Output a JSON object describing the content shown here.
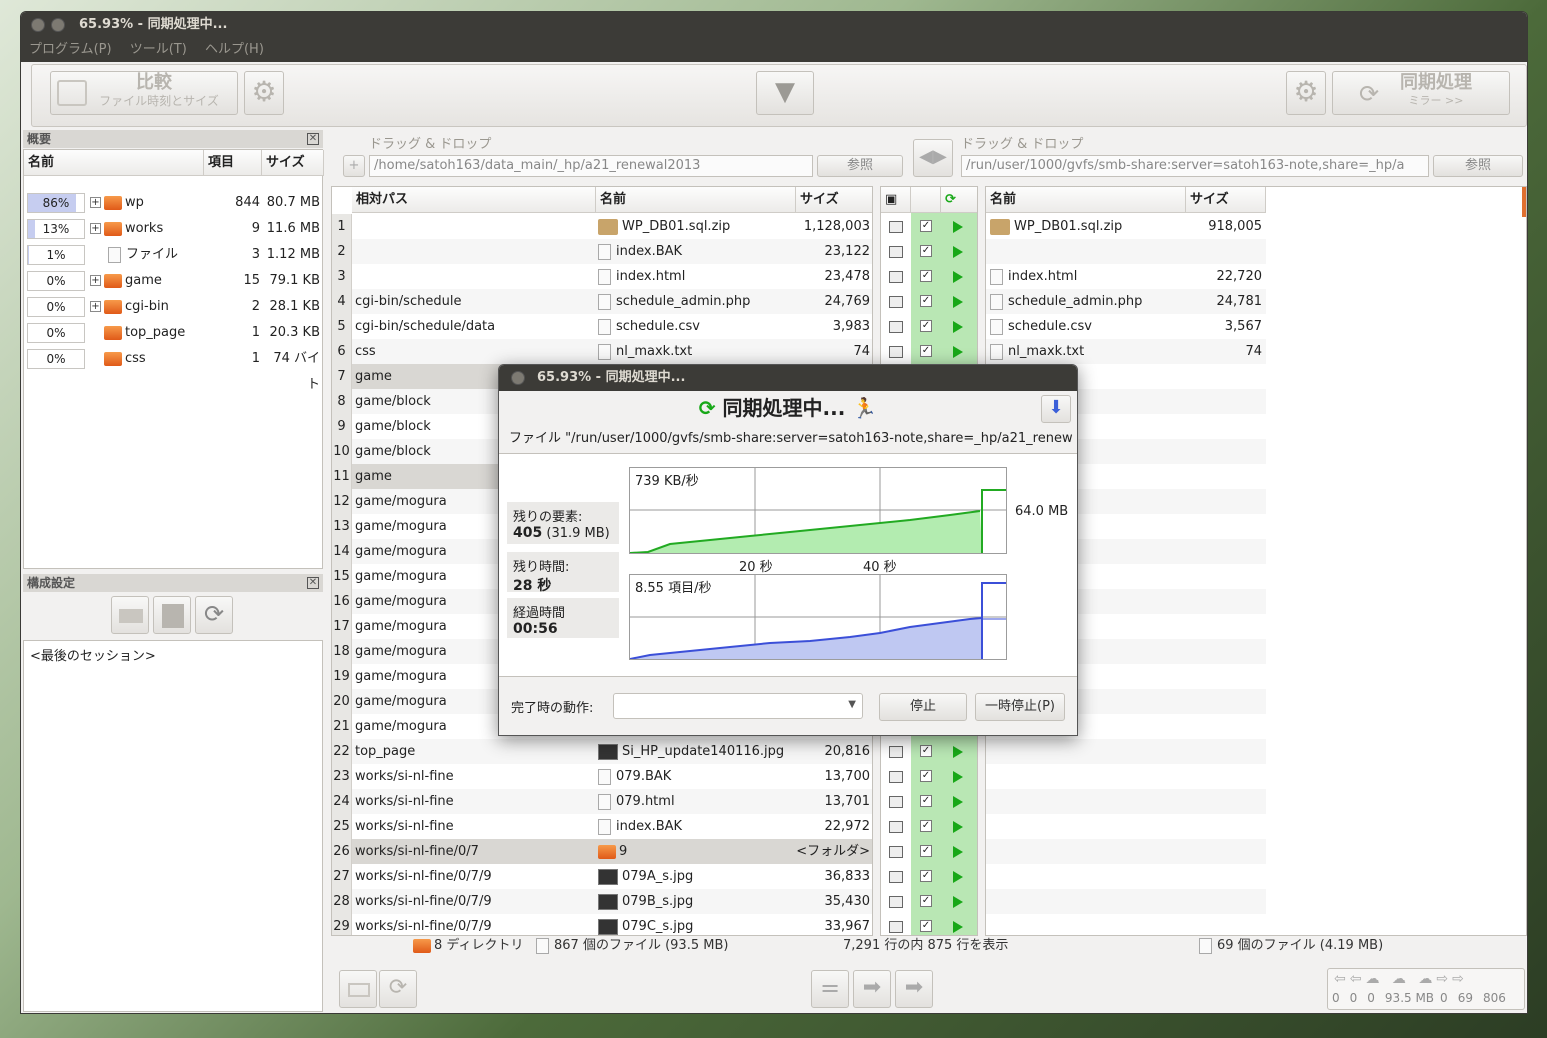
{
  "window": {
    "title": "65.93% - 同期処理中..."
  },
  "menu": [
    "プログラム(P)",
    "ツール(T)",
    "ヘルプ(H)"
  ],
  "toolbar": {
    "compare_label": "比較",
    "compare_sub": "ファイル時刻とサイズ",
    "sync_label": "同期処理",
    "sync_sub": "ミラー >>"
  },
  "overview": {
    "title": "概要",
    "cols": [
      "名前",
      "項目",
      "サイズ"
    ],
    "rows": [
      {
        "pct": "86%",
        "fill": 86,
        "name": "wp",
        "items": "844",
        "size": "80.7 MB",
        "expand": true,
        "folder": true
      },
      {
        "pct": "13%",
        "fill": 13,
        "name": "works",
        "items": "9",
        "size": "11.6 MB",
        "expand": true,
        "folder": true
      },
      {
        "pct": "1%",
        "fill": 1,
        "name": "ファイル",
        "items": "3",
        "size": "1.12 MB",
        "expand": false,
        "folder": false
      },
      {
        "pct": "0%",
        "fill": 0,
        "name": "game",
        "items": "15",
        "size": "79.1 KB",
        "expand": true,
        "folder": true
      },
      {
        "pct": "0%",
        "fill": 0,
        "name": "cgi-bin",
        "items": "2",
        "size": "28.1 KB",
        "expand": true,
        "folder": true
      },
      {
        "pct": "0%",
        "fill": 0,
        "name": "top_page",
        "items": "1",
        "size": "20.3 KB",
        "expand": false,
        "folder": true
      },
      {
        "pct": "0%",
        "fill": 0,
        "name": "css",
        "items": "1",
        "size": "74 バイト",
        "expand": false,
        "folder": true
      }
    ]
  },
  "config": {
    "title": "構成設定",
    "session": "<最後のセッション>"
  },
  "left": {
    "dnd": "ドラッグ & ドロップ",
    "path": "/home/satoh163/data_main/_hp/a21_renewal2013",
    "browse": "参照",
    "cols": [
      "相対パス",
      "名前",
      "サイズ"
    ]
  },
  "right": {
    "dnd": "ドラッグ & ドロップ",
    "path": "/run/user/1000/gvfs/smb-share:server=satoh163-note,share=_hp/a",
    "browse": "参照",
    "cols": [
      "名前",
      "サイズ"
    ]
  },
  "rows": [
    {
      "n": "1",
      "path": "",
      "name": "WP_DB01.sql.zip",
      "size": "1,128,003",
      "icon": "zip",
      "rname": "WP_DB01.sql.zip",
      "rsize": "918,005",
      "ricon": "zip",
      "act": "right"
    },
    {
      "n": "2",
      "path": "",
      "name": "index.BAK",
      "size": "23,122",
      "icon": "file",
      "rname": "",
      "rsize": "",
      "ricon": "",
      "act": "plus"
    },
    {
      "n": "3",
      "path": "",
      "name": "index.html",
      "size": "23,478",
      "icon": "file",
      "rname": "index.html",
      "rsize": "22,720",
      "ricon": "file",
      "act": "right"
    },
    {
      "n": "4",
      "path": "cgi-bin/schedule",
      "name": "schedule_admin.php",
      "size": "24,769",
      "icon": "file",
      "rname": "schedule_admin.php",
      "rsize": "24,781",
      "ricon": "file",
      "act": "right"
    },
    {
      "n": "5",
      "path": "cgi-bin/schedule/data",
      "name": "schedule.csv",
      "size": "3,983",
      "icon": "file",
      "rname": "schedule.csv",
      "rsize": "3,567",
      "ricon": "file",
      "act": "right"
    },
    {
      "n": "6",
      "path": "css",
      "name": "nl_maxk.txt",
      "size": "74",
      "icon": "file",
      "rname": "nl_maxk.txt",
      "rsize": "74",
      "ricon": "file",
      "act": "right"
    },
    {
      "n": "7",
      "path": "game",
      "name": "",
      "size": "",
      "icon": "",
      "rname": "",
      "rsize": "",
      "ricon": "",
      "act": "",
      "dir": true
    },
    {
      "n": "8",
      "path": "game/block",
      "name": "",
      "size": "",
      "icon": "",
      "rname": "",
      "rsize": "",
      "ricon": "",
      "act": ""
    },
    {
      "n": "9",
      "path": "game/block",
      "name": "",
      "size": "",
      "icon": "",
      "rname": "",
      "rsize": "",
      "ricon": "",
      "act": ""
    },
    {
      "n": "10",
      "path": "game/block",
      "name": "",
      "size": "",
      "icon": "",
      "rname": "",
      "rsize": "",
      "ricon": "",
      "act": ""
    },
    {
      "n": "11",
      "path": "game",
      "name": "",
      "size": "",
      "icon": "",
      "rname": "",
      "rsize": "",
      "ricon": "",
      "act": "",
      "dir": true
    },
    {
      "n": "12",
      "path": "game/mogura",
      "name": "",
      "size": "",
      "icon": "",
      "rname": "",
      "rsize": "",
      "ricon": "",
      "act": ""
    },
    {
      "n": "13",
      "path": "game/mogura",
      "name": "",
      "size": "",
      "icon": "",
      "rname": "",
      "rsize": "",
      "ricon": "",
      "act": ""
    },
    {
      "n": "14",
      "path": "game/mogura",
      "name": "",
      "size": "",
      "icon": "",
      "rname": "",
      "rsize": "",
      "ricon": "",
      "act": ""
    },
    {
      "n": "15",
      "path": "game/mogura",
      "name": "",
      "size": "",
      "icon": "",
      "rname": "",
      "rsize": "",
      "ricon": "",
      "act": ""
    },
    {
      "n": "16",
      "path": "game/mogura",
      "name": "",
      "size": "",
      "icon": "",
      "rname": "",
      "rsize": "",
      "ricon": "",
      "act": ""
    },
    {
      "n": "17",
      "path": "game/mogura",
      "name": "",
      "size": "",
      "icon": "",
      "rname": "",
      "rsize": "",
      "ricon": "",
      "act": ""
    },
    {
      "n": "18",
      "path": "game/mogura",
      "name": "",
      "size": "",
      "icon": "",
      "rname": "",
      "rsize": "",
      "ricon": "",
      "act": ""
    },
    {
      "n": "19",
      "path": "game/mogura",
      "name": "",
      "size": "",
      "icon": "",
      "rname": "",
      "rsize": "",
      "ricon": "",
      "act": ""
    },
    {
      "n": "20",
      "path": "game/mogura",
      "name": "",
      "size": "",
      "icon": "",
      "rname": "",
      "rsize": "",
      "ricon": "",
      "act": ""
    },
    {
      "n": "21",
      "path": "game/mogura",
      "name": "",
      "size": "",
      "icon": "",
      "rname": "",
      "rsize": "",
      "ricon": "",
      "act": ""
    },
    {
      "n": "22",
      "path": "top_page",
      "name": "Si_HP_update140116.jpg",
      "size": "20,816",
      "icon": "img",
      "rname": "",
      "rsize": "",
      "ricon": "",
      "act": "plus"
    },
    {
      "n": "23",
      "path": "works/si-nl-fine",
      "name": "079.BAK",
      "size": "13,700",
      "icon": "file",
      "rname": "",
      "rsize": "",
      "ricon": "",
      "act": "plus"
    },
    {
      "n": "24",
      "path": "works/si-nl-fine",
      "name": "079.html",
      "size": "13,701",
      "icon": "file",
      "rname": "",
      "rsize": "",
      "ricon": "",
      "act": "plus"
    },
    {
      "n": "25",
      "path": "works/si-nl-fine",
      "name": "index.BAK",
      "size": "22,972",
      "icon": "file",
      "rname": "",
      "rsize": "",
      "ricon": "",
      "act": "plus"
    },
    {
      "n": "26",
      "path": "works/si-nl-fine/0/7",
      "name": "9",
      "size": "<フォルダ>",
      "icon": "folder",
      "rname": "",
      "rsize": "",
      "ricon": "",
      "act": "plus",
      "dir": true
    },
    {
      "n": "27",
      "path": "works/si-nl-fine/0/7/9",
      "name": "079A_s.jpg",
      "size": "36,833",
      "icon": "img",
      "rname": "",
      "rsize": "",
      "ricon": "",
      "act": "plus"
    },
    {
      "n": "28",
      "path": "works/si-nl-fine/0/7/9",
      "name": "079B_s.jpg",
      "size": "35,430",
      "icon": "img",
      "rname": "",
      "rsize": "",
      "ricon": "",
      "act": "plus"
    },
    {
      "n": "29",
      "path": "works/si-nl-fine/0/7/9",
      "name": "079C_s.jpg",
      "size": "33,967",
      "icon": "img",
      "rname": "",
      "rsize": "",
      "ricon": "",
      "act": "plus"
    }
  ],
  "status": {
    "dirs": "8 ディレクトリ",
    "lfiles": "867 個のファイル (93.5 MB)",
    "rows": "7,291 行の内 875 行を表示",
    "rfiles": "69 個のファイル (4.19 MB)"
  },
  "counters": [
    "0",
    "0",
    "0",
    "93.5 MB",
    "0",
    "69",
    "806"
  ],
  "dialog": {
    "title": "65.93% - 同期処理中...",
    "heading": "同期処理中...",
    "file": "ファイル \"/run/user/1000/gvfs/smb-share:server=satoh163-note,share=_hp/a21_renew",
    "remain_label": "残りの要素:",
    "remain_count": "405",
    "remain_size": "(31.9 MB)",
    "time_label": "残り時間:",
    "time_value": "28 秒",
    "elapsed_label": "経過時間",
    "elapsed_value": "00:56",
    "speed": "739 KB/秒",
    "total": "64.0 MB",
    "t20": "20 秒",
    "t40": "40 秒",
    "items_rate": "8.55 項目/秒",
    "done_label": "完了時の動作:",
    "stop": "停止",
    "pause": "一時停止(P)"
  }
}
